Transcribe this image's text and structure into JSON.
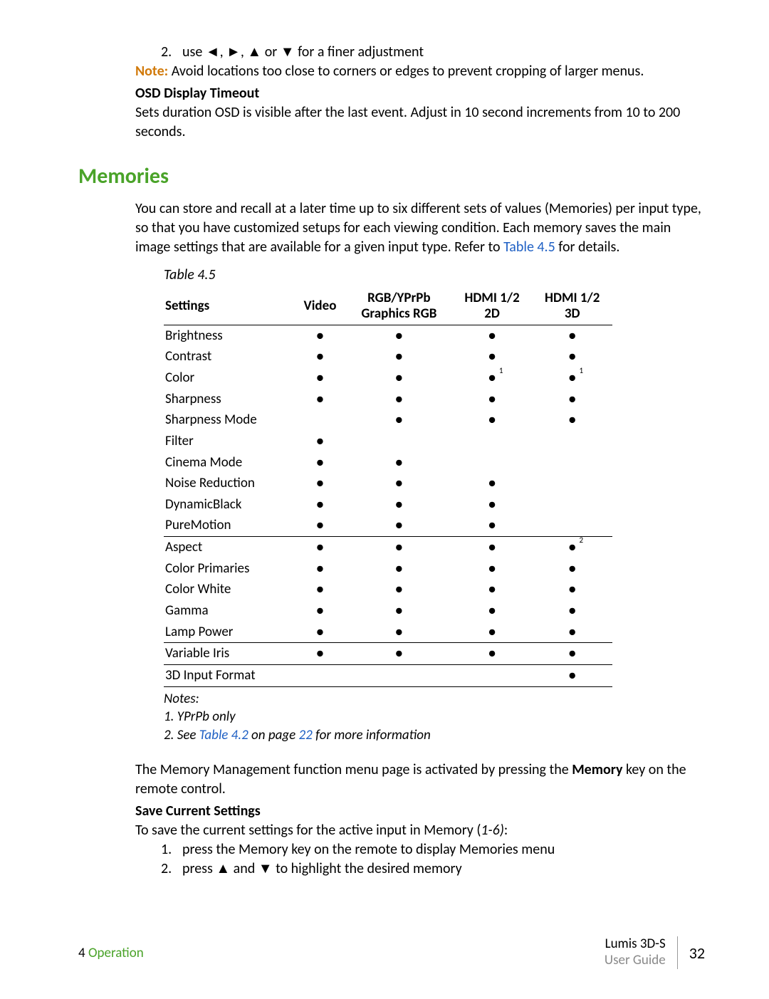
{
  "intro": {
    "step2_num": "2.",
    "step2_text": "use ◄, ►, ▲ or ▼ for a finer adjustment",
    "note_label": "Note:",
    "note_text": " Avoid locations too close to corners or edges to prevent cropping of larger menus.",
    "osd_head": "OSD Display Timeout",
    "osd_body": "Sets duration OSD is visible after the last event. Adjust in 10 second increments from 10 to 200 seconds."
  },
  "section_title": "Memories",
  "memories_para_a": "You can store and recall at a later time up to six different sets of values (Memories) per input type, so that you have customized setups for each viewing condition. Each memory saves the main image settings that are available for a given input type. Refer to ",
  "memories_para_link": "Table 4.5",
  "memories_para_b": " for details.",
  "table_caption": "Table 4.5",
  "table": {
    "head": {
      "settings": "Settings",
      "video": "Video",
      "rgb1": "RGB/YPrPb",
      "rgb2": "Graphics RGB",
      "hdmi2d_1": "HDMI 1/2",
      "hdmi2d_2": "2D",
      "hdmi3d_1": "HDMI 1/2",
      "hdmi3d_2": "3D"
    },
    "groups": [
      {
        "rows": [
          {
            "label": "Brightness",
            "cells": [
              "●",
              "●",
              "●",
              "●"
            ]
          },
          {
            "label": "Contrast",
            "cells": [
              "●",
              "●",
              "●",
              "●"
            ]
          },
          {
            "label": "Color",
            "cells": [
              "●",
              "●",
              "●1",
              "●1"
            ]
          },
          {
            "label": "Sharpness",
            "cells": [
              "●",
              "●",
              "●",
              "●"
            ]
          },
          {
            "label": "Sharpness Mode",
            "cells": [
              "",
              "●",
              "●",
              "●"
            ]
          },
          {
            "label": "Filter",
            "cells": [
              "●",
              "",
              "",
              ""
            ]
          },
          {
            "label": "Cinema Mode",
            "cells": [
              "●",
              "●",
              "",
              ""
            ]
          },
          {
            "label": "Noise Reduction",
            "cells": [
              "●",
              "●",
              "●",
              ""
            ]
          },
          {
            "label": "DynamicBlack",
            "cells": [
              "●",
              "●",
              "●",
              ""
            ]
          },
          {
            "label": "PureMotion",
            "cells": [
              "●",
              "●",
              "●",
              ""
            ]
          }
        ]
      },
      {
        "rows": [
          {
            "label": "Aspect",
            "cells": [
              "●",
              "●",
              "●",
              "●2"
            ]
          },
          {
            "label": "Color Primaries",
            "cells": [
              "●",
              "●",
              "●",
              "●"
            ]
          },
          {
            "label": "Color White",
            "cells": [
              "●",
              "●",
              "●",
              "●"
            ]
          },
          {
            "label": "Gamma",
            "cells": [
              "●",
              "●",
              "●",
              "●"
            ]
          },
          {
            "label": "Lamp Power",
            "cells": [
              "●",
              "●",
              "●",
              "●"
            ]
          }
        ]
      },
      {
        "rows": [
          {
            "label": "Variable Iris",
            "cells": [
              "●",
              "●",
              "●",
              "●"
            ]
          }
        ]
      },
      {
        "rows": [
          {
            "label": "3D Input Format",
            "cells": [
              "",
              "",
              "",
              "●"
            ]
          }
        ]
      }
    ]
  },
  "table_notes": {
    "head": "Notes:",
    "n1": "1. YPrPb only",
    "n2a": "2. See ",
    "n2_link1": "Table 4.2",
    "n2b": " on page ",
    "n2_link2": "22",
    "n2c": " for more information"
  },
  "post": {
    "para_a": "The Memory Management function menu page is activated by pressing the ",
    "para_bold": "Memory",
    "para_b": " key on the remote control.",
    "save_head": "Save Current Settings",
    "save_intro_a": "To save the current settings for the active input in Memory (",
    "save_intro_italic": "1-6)",
    "save_intro_b": ":",
    "s1_num": "1.",
    "s1": "press the Memory key on the remote to display Memories menu",
    "s2_num": "2.",
    "s2": "press ▲ and ▼ to highlight the desired memory"
  },
  "footer": {
    "chapter_num": "4",
    "chapter_name": "Operation",
    "doc_title": "Lumis 3D-S",
    "doc_sub": "User Guide",
    "page": "32"
  }
}
